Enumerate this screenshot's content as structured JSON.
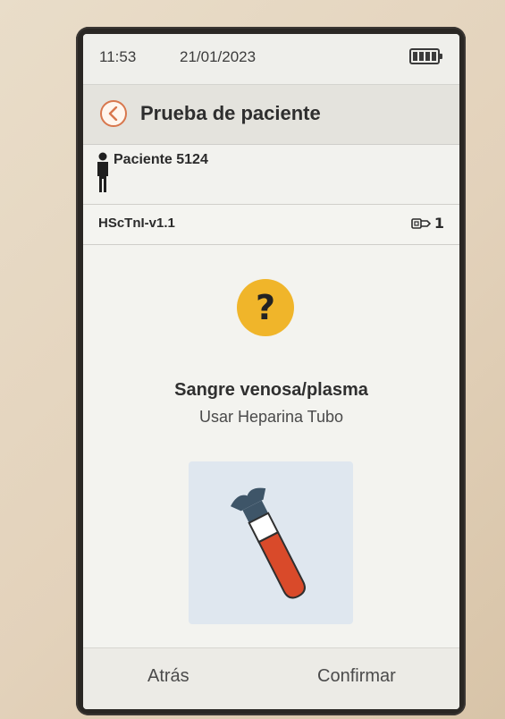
{
  "status": {
    "time": "11:53",
    "date": "21/01/2023"
  },
  "header": {
    "title": "Prueba de paciente"
  },
  "patient": {
    "label": "Paciente 5124"
  },
  "test": {
    "name": "HScTnI-v1.1",
    "cartridge_count": "1"
  },
  "prompt": {
    "icon_symbol": "?",
    "title": "Sangre venosa/plasma",
    "subtitle": "Usar Heparina Tubo"
  },
  "footer": {
    "back_label": "Atrás",
    "confirm_label": "Confirmar"
  },
  "icons": {
    "back": "chevron-left-icon",
    "patient": "person-icon",
    "cartridge": "cartridge-icon",
    "battery": "battery-icon",
    "prompt": "question-mark-icon",
    "sample": "blood-tube-icon"
  },
  "colors": {
    "accent": "#d8774d",
    "warning": "#f0b52a",
    "blood": "#d94a2a",
    "tube_card": "#dfe7ef"
  }
}
